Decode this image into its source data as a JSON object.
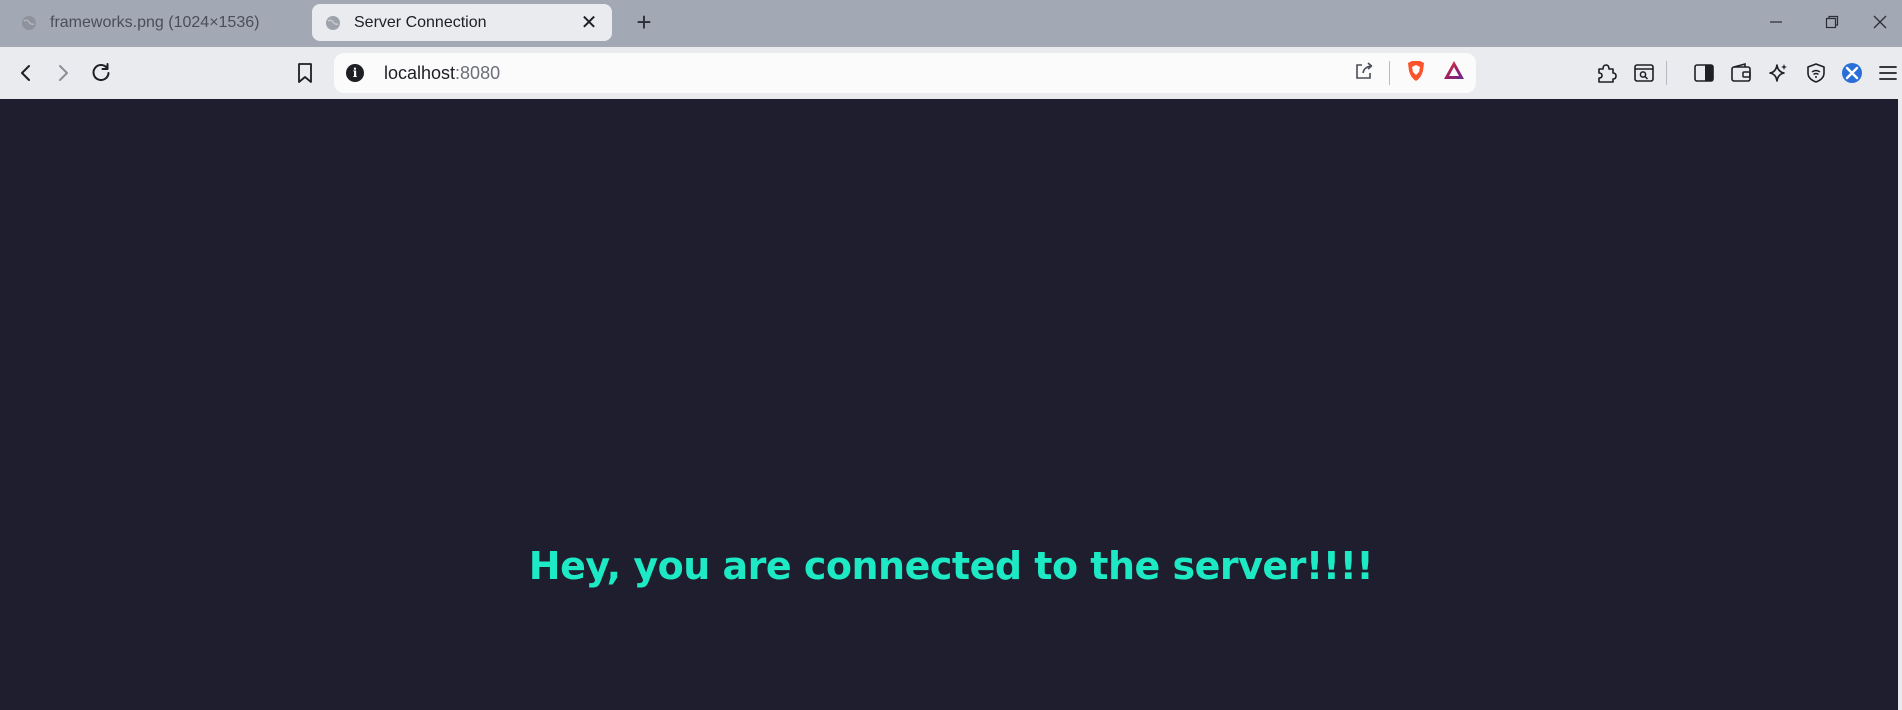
{
  "tabs": [
    {
      "title": "frameworks.png (1024×1536)",
      "active": false
    },
    {
      "title": "Server Connection",
      "active": true
    }
  ],
  "address_bar": {
    "host": "localhost",
    "port": ":8080"
  },
  "page": {
    "message": "Hey, you are connected to the server!!!!"
  },
  "colors": {
    "page_background": "#1e1e2e",
    "message_text": "#1de9c4",
    "tab_strip": "#a3a8b5",
    "toolbar": "#e9ebef"
  },
  "icons": [
    "globe-icon",
    "close-icon",
    "plus-icon",
    "minimize-icon",
    "restore-icon",
    "window-close-icon",
    "back-icon",
    "forward-icon",
    "reload-icon",
    "bookmark-icon",
    "info-icon",
    "share-icon",
    "brave-shield-icon",
    "brave-rewards-icon",
    "extensions-icon",
    "tab-search-icon",
    "sidebar-icon",
    "wallet-icon",
    "leo-ai-icon",
    "vpn-icon",
    "extension-x-icon",
    "menu-icon"
  ]
}
